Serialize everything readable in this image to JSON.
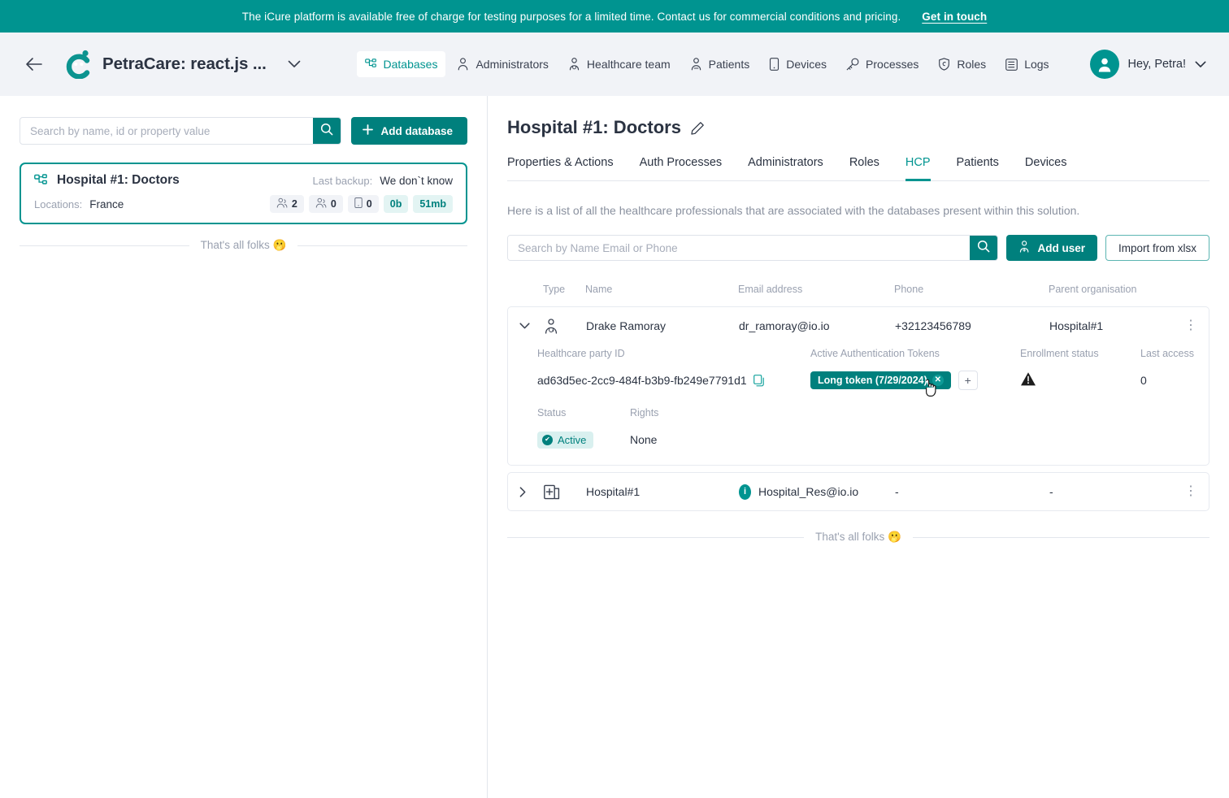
{
  "banner": {
    "message": "The iCure platform is available free of charge for testing purposes for a limited time. Contact us for commercial conditions and pricing.",
    "link_label": "Get in touch",
    "bg_color": "#009490"
  },
  "header": {
    "back_label": "←",
    "app_title": "PetraCare: react.js ...",
    "nav": [
      {
        "label": "Databases",
        "icon": "database-nodes-icon",
        "active": true
      },
      {
        "label": "Administrators",
        "icon": "person-icon",
        "active": false
      },
      {
        "label": "Healthcare team",
        "icon": "doctor-icon",
        "active": false
      },
      {
        "label": "Patients",
        "icon": "patient-icon",
        "active": false
      },
      {
        "label": "Devices",
        "icon": "device-icon",
        "active": false
      },
      {
        "label": "Processes",
        "icon": "key-icon",
        "active": false
      },
      {
        "label": "Roles",
        "icon": "shield-icon",
        "active": false
      },
      {
        "label": "Logs",
        "icon": "list-icon",
        "active": false
      }
    ],
    "user": {
      "greeting": "Hey, Petra!"
    },
    "accent_color": "#009490"
  },
  "sidebar": {
    "search": {
      "placeholder": "Search by name, id or property value",
      "value": ""
    },
    "add_database_label": "Add database",
    "databases": [
      {
        "name": "Hospital #1: Doctors",
        "backup_label": "Last backup:",
        "backup_value": "We don`t know",
        "locations_label": "Locations:",
        "locations_value": "France",
        "stats": [
          {
            "icon": "doctors-group-icon",
            "value": "2",
            "tone": "grey"
          },
          {
            "icon": "patients-group-icon",
            "value": "0",
            "tone": "grey"
          },
          {
            "icon": "device-icon",
            "value": "0",
            "tone": "grey"
          },
          {
            "icon": "",
            "value": "0b",
            "tone": "teal"
          },
          {
            "icon": "",
            "value": "51mb",
            "tone": "teal"
          }
        ]
      }
    ],
    "end_of_list": "That's all folks 🫢"
  },
  "main": {
    "title": "Hospital #1: Doctors",
    "tabs": [
      {
        "label": "Properties & Actions",
        "active": false
      },
      {
        "label": "Auth Processes",
        "active": false
      },
      {
        "label": "Administrators",
        "active": false
      },
      {
        "label": "Roles",
        "active": false
      },
      {
        "label": "HCP",
        "active": true
      },
      {
        "label": "Patients",
        "active": false
      },
      {
        "label": "Devices",
        "active": false
      }
    ],
    "description": "Here is a list of all the healthcare professionals that are associated with the databases present within this solution.",
    "search": {
      "placeholder": "Search by Name Email or Phone",
      "value": ""
    },
    "add_user_label": "Add user",
    "import_label": "Import from xlsx",
    "table": {
      "columns": [
        "Type",
        "Name",
        "Email address",
        "Phone",
        "Parent organisation"
      ],
      "rows": [
        {
          "expanded": true,
          "type_icon": "doctor-icon",
          "name": "Drake Ramoray",
          "email": "dr_ramoray@io.io",
          "email_badge": "",
          "phone": "+32123456789",
          "parent": "Hospital#1",
          "detail": {
            "hcp_id_label": "Healthcare party ID",
            "hcp_id_value": "ad63d5ec-2cc9-484f-b3b9-fb249e7791d1",
            "tokens_label": "Active Authentication Tokens",
            "tokens": [
              "Long token (7/29/2024)"
            ],
            "add_token_label": "+",
            "enrollment_label": "Enrollment status",
            "enrollment_icon": "warning-triangle-icon",
            "last_access_label": "Last access",
            "last_access_value": "0",
            "status_label": "Status",
            "status_value": "Active",
            "rights_label": "Rights",
            "rights_value": "None"
          }
        },
        {
          "expanded": false,
          "type_icon": "hospital-icon",
          "name": "Hospital#1",
          "email": "Hospital_Res@io.io",
          "email_badge": "i",
          "phone": "-",
          "parent": "-",
          "detail": null
        }
      ]
    },
    "end_of_list": "That's all folks 🫢"
  }
}
